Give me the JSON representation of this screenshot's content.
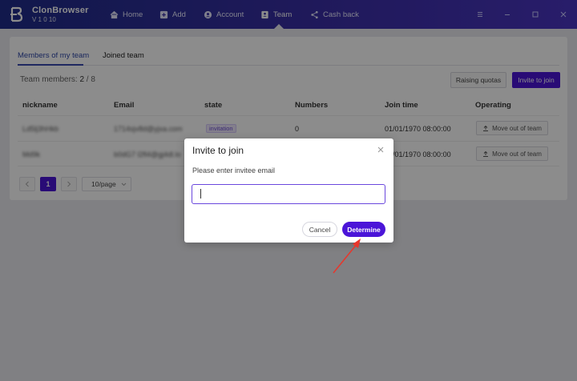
{
  "app": {
    "name": "ClonBrowser",
    "version": "V 1 0 10",
    "nav": [
      {
        "label": "Home",
        "icon": "home-icon"
      },
      {
        "label": "Add",
        "icon": "plus-square-icon"
      },
      {
        "label": "Account",
        "icon": "user-circle-icon"
      },
      {
        "label": "Team",
        "icon": "team-icon",
        "active": true
      },
      {
        "label": "Cash back",
        "icon": "share-icon"
      }
    ]
  },
  "tabs": [
    "Members of my team",
    "Joined team"
  ],
  "team": {
    "members_label": "Team members:",
    "members_current": "2",
    "members_sep": " / ",
    "members_max": "8",
    "raise_button": "Raising quotas",
    "invite_button": "Invite to join"
  },
  "table": {
    "headers": [
      "nickname",
      "Email",
      "state",
      "Numbers",
      "Join time",
      "Operating"
    ],
    "rows": [
      {
        "nickname": "Ld5lj3hHkb",
        "email": "1714sjv8d@yjxa.com",
        "state": "invitation",
        "numbers": "0",
        "join_time": "01/01/1970 08:00:00",
        "operating": "Move out of team"
      },
      {
        "nickname": "Md9k",
        "email": "b0dG7 l2fl4@gj4dl.lo",
        "state": "",
        "numbers": "",
        "join_time": "01/01/1970 08:00:00",
        "operating": "Move out of team"
      }
    ]
  },
  "pagination": {
    "current": "1",
    "page_size": "10/page"
  },
  "modal": {
    "title": "Invite to join",
    "label": "Please enter invitee email",
    "input_value": "",
    "cancel": "Cancel",
    "confirm": "Determine"
  },
  "colors": {
    "accent": "#4b15d8",
    "header_start": "#1f2d8a",
    "header_end": "#4a35c2",
    "annotation_arrow": "#e8362b"
  }
}
